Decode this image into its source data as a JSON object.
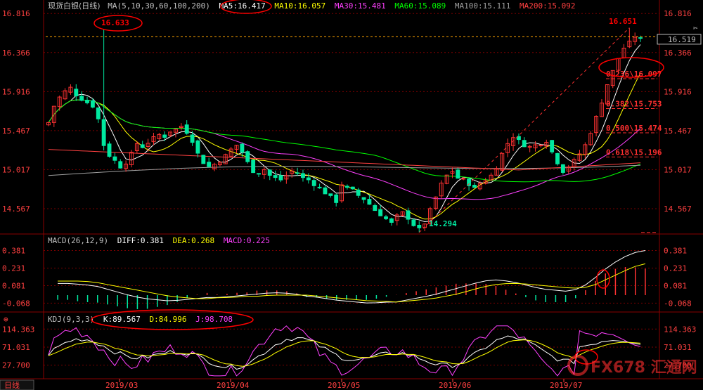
{
  "colors": {
    "up": "#ff3232",
    "down": "#00e8a0",
    "grid": "#7a0000",
    "axis_text": "#ff4040",
    "ma5": "#ffffff",
    "ma10": "#ffff00",
    "ma30": "#ff40ff",
    "ma60": "#00ff00",
    "ma100": "#a0a0a0",
    "ma200": "#ff4040",
    "kdj_k": "#ffffff",
    "kdj_d": "#ffff00",
    "kdj_j": "#ff40ff",
    "annotation": "#ff0000",
    "fib": "#ff3030",
    "ref": "#ffa500"
  },
  "header": {
    "title": "现货白银(日线)",
    "ma_prefix": "MA(5,10,30,60,100,200)",
    "ma5": "MA5:16.417",
    "ma10": "MA10:16.057",
    "ma30": "MA30:15.481",
    "ma60": "MA60:15.089",
    "ma100": "MA100:15.111",
    "ma200": "MA200:15.092"
  },
  "macd_header": {
    "prefix": "MACD(26,12,9)",
    "diff": "DIFF:0.381",
    "dea": "DEA:0.268",
    "macd": "MACD:0.225"
  },
  "kdj_header": {
    "prefix": "KDJ(9,3,3)",
    "k": "K:89.567",
    "d": "D:84.996",
    "j": "J:98.708"
  },
  "price_label": "16.519",
  "period_label": "日线",
  "watermark": "FX678 汇通网",
  "chart_data": {
    "type": "candlestick",
    "x_ticks": [
      "2019/03",
      "2019/04",
      "2019/05",
      "2019/06",
      "2019/07"
    ],
    "y_ticks_main": [
      "16.816",
      "16.366",
      "15.916",
      "15.467",
      "15.017",
      "14.567"
    ],
    "y_ticks_macd": [
      "0.381",
      "0.231",
      "0.081",
      "-0.068"
    ],
    "y_ticks_kdj": [
      "114.363",
      "71.031",
      "27.700"
    ],
    "ylim_main": [
      14.3,
      16.85
    ],
    "ylim_macd": [
      -0.12,
      0.42
    ],
    "ylim_kdj": [
      0,
      125
    ],
    "annotations": {
      "high1": "16.633",
      "high2": "16.651",
      "low": "14.294",
      "current": "16.519"
    },
    "fib_levels": [
      {
        "ratio": "0.236",
        "value": "16.097",
        "price": 16.097
      },
      {
        "ratio": "0.382",
        "value": "15.753",
        "price": 15.753
      },
      {
        "ratio": "0.500",
        "value": "15.474",
        "price": 15.474
      },
      {
        "ratio": "0.618",
        "value": "15.196",
        "price": 15.196
      }
    ],
    "close_anchors": [
      15.56,
      15.75,
      15.85,
      15.92,
      15.96,
      15.88,
      15.83,
      15.79,
      15.75,
      15.6,
      15.3,
      15.18,
      15.12,
      15.05,
      15.1,
      15.2,
      15.32,
      15.28,
      15.33,
      15.38,
      15.42,
      15.4,
      15.46,
      15.48,
      15.52,
      15.45,
      15.35,
      15.2,
      15.1,
      15.05,
      15.08,
      15.12,
      15.18,
      15.25,
      15.3,
      15.22,
      15.1,
      15.0,
      14.98,
      15.02,
      14.95,
      14.92,
      14.9,
      14.95,
      15.0,
      14.98,
      14.92,
      14.9,
      14.85,
      14.8,
      14.75,
      14.7,
      14.65,
      14.85,
      14.8,
      14.78,
      14.72,
      14.68,
      14.62,
      14.55,
      14.5,
      14.45,
      14.4,
      14.48,
      14.52,
      14.46,
      14.38,
      14.33,
      14.4,
      14.55,
      14.7,
      14.85,
      14.95,
      15.0,
      14.92,
      14.9,
      14.85,
      14.8,
      14.86,
      14.9,
      14.95,
      15.05,
      15.2,
      15.32,
      15.4,
      15.35,
      15.3,
      15.28,
      15.3,
      15.32,
      15.35,
      15.22,
      15.1,
      15.0,
      15.05,
      15.12,
      15.2,
      15.3,
      15.45,
      15.62,
      15.8,
      16.0,
      16.15,
      16.3,
      16.42,
      16.48,
      16.55,
      16.519
    ],
    "diff_anchors": [
      0.1,
      0.1,
      0.09,
      0.08,
      0.05,
      0.02,
      -0.01,
      -0.03,
      -0.04,
      -0.05,
      -0.04,
      -0.03,
      -0.02,
      -0.02,
      -0.01,
      0.0,
      0.01,
      0.02,
      0.02,
      0.01,
      -0.01,
      -0.02,
      -0.04,
      -0.05,
      -0.06,
      -0.07,
      -0.06,
      -0.06,
      -0.04,
      -0.02,
      0.0,
      0.03,
      0.06,
      0.09,
      0.12,
      0.13,
      0.12,
      0.1,
      0.07,
      0.05,
      0.04,
      0.03,
      0.07,
      0.15,
      0.24,
      0.31,
      0.36,
      0.381
    ],
    "dea_anchors": [
      0.12,
      0.12,
      0.12,
      0.11,
      0.09,
      0.07,
      0.05,
      0.03,
      0.01,
      -0.01,
      -0.02,
      -0.03,
      -0.03,
      -0.02,
      -0.02,
      -0.01,
      -0.01,
      0.0,
      0.0,
      0.0,
      0.0,
      -0.01,
      -0.02,
      -0.03,
      -0.04,
      -0.05,
      -0.05,
      -0.06,
      -0.05,
      -0.04,
      -0.03,
      -0.01,
      0.01,
      0.04,
      0.07,
      0.09,
      0.1,
      0.1,
      0.09,
      0.08,
      0.07,
      0.06,
      0.06,
      0.09,
      0.14,
      0.19,
      0.24,
      0.268
    ]
  }
}
